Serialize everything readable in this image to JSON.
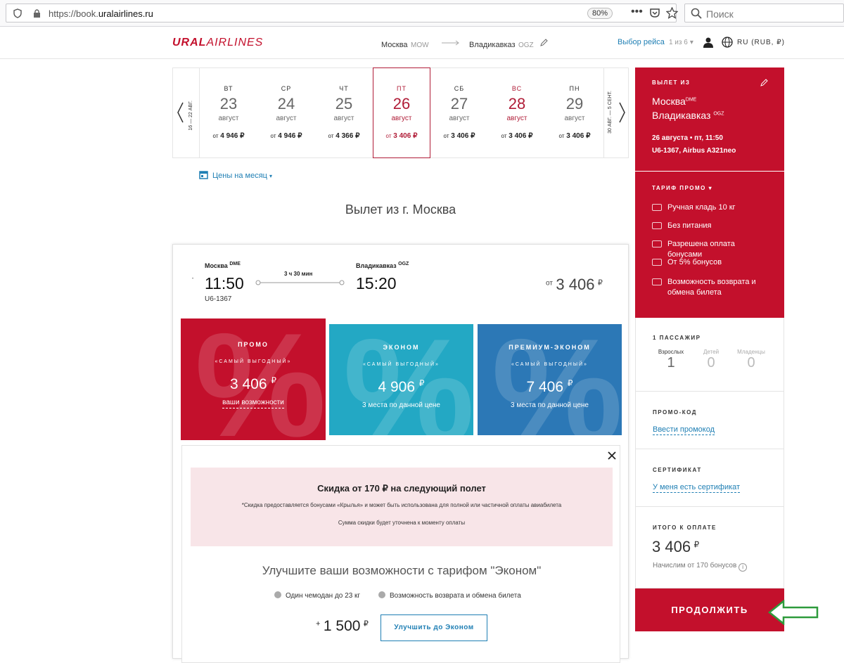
{
  "browser": {
    "url_prefix": "https://book.",
    "url_domain": "uralairlines.ru",
    "zoom": "80%",
    "search_placeholder": "Поиск"
  },
  "header": {
    "logo_bold": "URAL",
    "logo_light": "AIRLINES",
    "from_city": "Москва",
    "from_code": "MOW",
    "to_city": "Владикавказ",
    "to_code": "OGZ",
    "flight_select": "Выбор рейса",
    "flight_step": "1 из 6",
    "lang": "RU (RUB, ₽)"
  },
  "dates": {
    "prev_range": "16 — 22 АВГ.",
    "next_range": "30 АВГ. — 5 СЕНТ.",
    "days": [
      {
        "dow": "ВТ",
        "num": "23",
        "mon": "август",
        "price": "4 946 ₽"
      },
      {
        "dow": "СР",
        "num": "24",
        "mon": "август",
        "price": "4 946 ₽"
      },
      {
        "dow": "ЧТ",
        "num": "25",
        "mon": "август",
        "price": "4 366 ₽"
      },
      {
        "dow": "ПТ",
        "num": "26",
        "mon": "август",
        "price": "3 406 ₽"
      },
      {
        "dow": "СБ",
        "num": "27",
        "mon": "август",
        "price": "3 406 ₽"
      },
      {
        "dow": "ВС",
        "num": "28",
        "mon": "август",
        "price": "3 406 ₽"
      },
      {
        "dow": "ПН",
        "num": "29",
        "mon": "август",
        "price": "3 406 ₽"
      }
    ],
    "price_prefix": "от"
  },
  "main": {
    "month_link": "Цены на месяц",
    "title": "Вылет из г. Москва",
    "flight": {
      "from_city": "Москва",
      "from_code": "DME",
      "dep_time": "11:50",
      "flight_no": "U6-1367",
      "duration": "3 ч 30 мин",
      "to_city": "Владикавказ",
      "to_code": "OGZ",
      "arr_time": "15:20",
      "price_prefix": "от",
      "price": "3 406",
      "currency": "₽"
    },
    "tariffs": [
      {
        "name": "ПРОМО",
        "sub": "«САМЫЙ ВЫГОДНЫЙ»",
        "price": "3 406",
        "note": "ваши возможности",
        "color": "#c3102c"
      },
      {
        "name": "ЭКОНОМ",
        "sub": "«САМЫЙ ВЫГОДНЫЙ»",
        "price": "4 906",
        "note": "3 места по данной цене",
        "color": "#23a8c4"
      },
      {
        "name": "ПРЕМИУМ-ЭКОНОМ",
        "sub": "«САМЫЙ ВЫГОДНЫЙ»",
        "price": "7 406",
        "note": "3 места по данной цене",
        "color": "#2c78b6"
      }
    ],
    "promo_box": {
      "title": "Скидка от 170 ₽ на следующий полет",
      "line1": "*Скидка предоставляется бонусами «Крылья» и может быть использована для полной или частичной оплаты авиабилета",
      "line2": "Сумма скидки будет уточнена к моменту оплаты"
    },
    "upgrade": {
      "title": "Улучшите ваши возможности с тарифом \"Эконом\"",
      "opt1": "Один чемодан до 23 кг",
      "opt2": "Возможность возврата и обмена билета",
      "plus": "+",
      "price": "1 500",
      "currency": "₽",
      "button": "Улучшить до Эконом"
    }
  },
  "sidebar": {
    "dep_label": "ВЫЛЕТ ИЗ",
    "from": "Москва",
    "from_code": "DME",
    "to": "Владикавказ",
    "to_code": "OGZ",
    "date": "26 августа • пт, 11:50",
    "flight": "U6-1367, Airbus A321neo",
    "tariff_label": "ТАРИФ ПРОМО",
    "features": [
      "Ручная кладь 10 кг",
      "Без питания",
      "Разрешена оплата бонусами",
      "От 5% бонусов",
      "Возможность возврата и обмена билета"
    ],
    "pax_label": "1 ПАССАЖИР",
    "pax": [
      {
        "label": "Взрослых",
        "value": "1"
      },
      {
        "label": "Детей",
        "value": "0"
      },
      {
        "label": "Младенцы",
        "value": "0"
      }
    ],
    "promo_label": "ПРОМО-КОД",
    "promo_link": "Ввести промокод",
    "cert_label": "СЕРТИФИКАТ",
    "cert_link": "У меня есть сертификат",
    "total_label": "ИТОГО К ОПЛАТЕ",
    "total": "3 406",
    "currency": "₽",
    "bonus": "Начислим от 170 бонусов",
    "continue": "ПРОДОЛЖИТЬ"
  },
  "colors": {
    "brand": "#c3102c",
    "link": "#1f7fb4",
    "arrow": "#2e9b3c"
  }
}
